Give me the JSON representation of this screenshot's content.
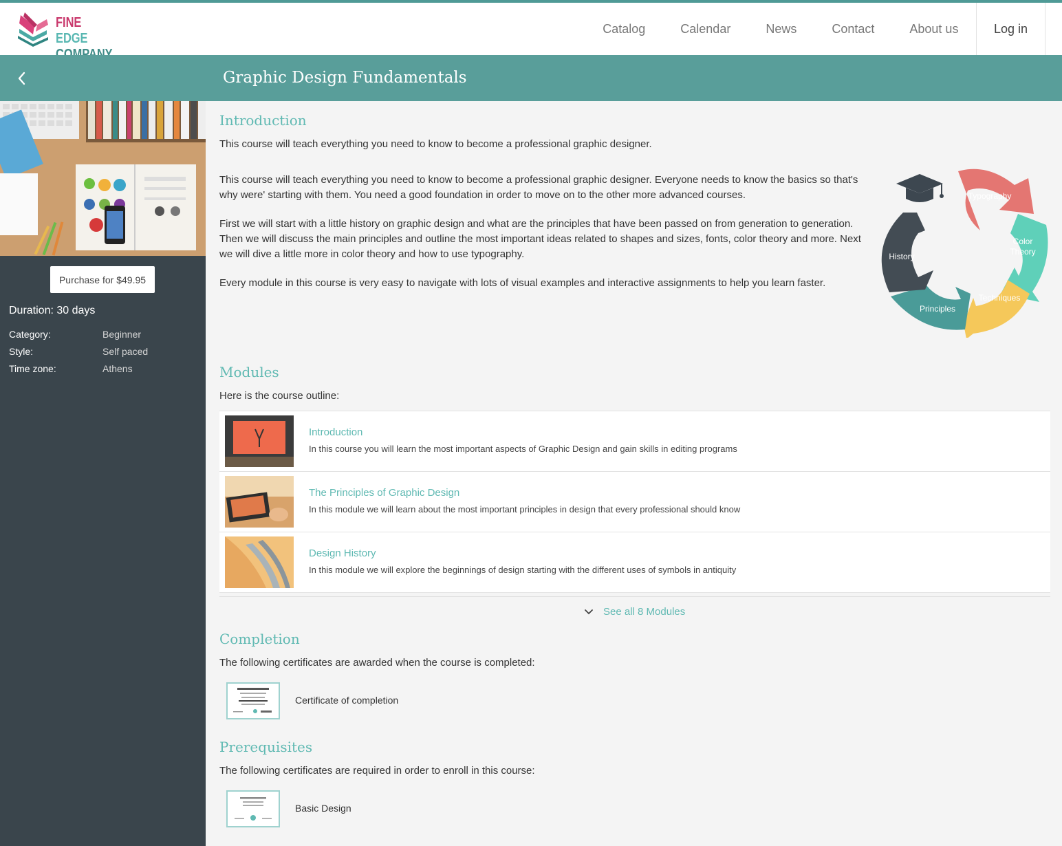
{
  "brand": {
    "line1_part1": "FINE",
    "line1_part2": "EDGE",
    "line2": "COMPANY"
  },
  "nav": {
    "items": [
      "Catalog",
      "Calendar",
      "News",
      "Contact",
      "About us"
    ],
    "login": "Log in"
  },
  "course": {
    "title": "Graphic Design Fundamentals",
    "purchase_label": "Purchase for $49.95",
    "duration": "Duration: 30 days",
    "meta": [
      {
        "key": "Category:",
        "value": "Beginner"
      },
      {
        "key": "Style:",
        "value": "Self paced"
      },
      {
        "key": "Time zone:",
        "value": "Athens"
      }
    ]
  },
  "introduction": {
    "heading": "Introduction",
    "summary": "This course will teach everything you need to know to become a professional graphic designer.",
    "paragraphs": [
      "This course will teach everything you need to know to become a professional graphic designer. Everyone needs to know the basics so that's why were' starting with them. You need a good foundation in order to move on to the other more advanced courses.",
      "First we will start with a little history on graphic design and what are the principles that have been passed on from generation to generation. Then we will discuss the main principles and outline the most important ideas related to shapes and sizes, fonts, color theory and more. Next we will dive a little more in color theory and how to use typography.",
      "Every module in this course is very easy to navigate with lots of visual examples and interactive assignments to help you learn faster."
    ],
    "cycle": {
      "segments": [
        "Typography",
        "Color",
        "Theory",
        "Techniques",
        "Principles",
        "History"
      ],
      "colors": {
        "typography": "#e57373",
        "color_theory": "#5fd0b9",
        "techniques": "#f5c85a",
        "principles": "#4a9b98",
        "history": "#434c54"
      }
    }
  },
  "modules": {
    "heading": "Modules",
    "intro": "Here is the course outline:",
    "items": [
      {
        "title": "Introduction",
        "description": "In this course you will learn the most important aspects of Graphic Design and gain skills in editing programs"
      },
      {
        "title": "The Principles of Graphic Design",
        "description": "In this module we will learn about the most important principles in design that every professional should know"
      },
      {
        "title": "Design History",
        "description": "In this module we will explore the beginnings of design starting with the different uses of symbols in antiquity"
      }
    ],
    "see_all": "See all 8 Modules"
  },
  "completion": {
    "heading": "Completion",
    "intro": "The following certificates are awarded when the course is completed:",
    "certificate": "Certificate of completion"
  },
  "prerequisites": {
    "heading": "Prerequisites",
    "intro": "The following certificates are required in order to enroll in this course:",
    "certificate": "Basic Design"
  },
  "colors": {
    "accent": "#5fb9b2",
    "titlebar": "#599e9a",
    "sidebar": "#3a454c",
    "background": "#f4f4f4"
  }
}
